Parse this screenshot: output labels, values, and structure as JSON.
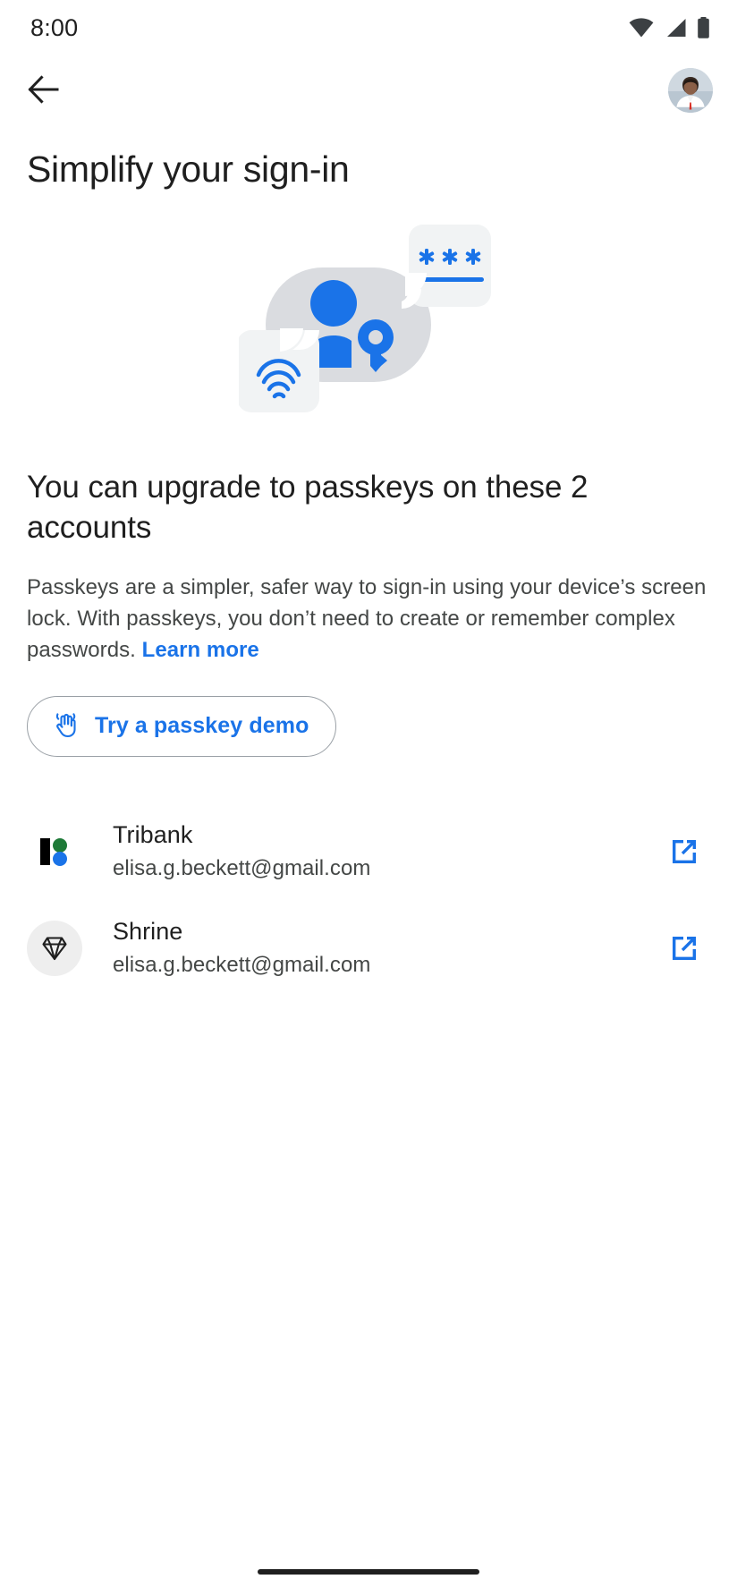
{
  "status_bar": {
    "time": "8:00",
    "icons": [
      "wifi-icon",
      "cellular-signal-icon",
      "battery-icon"
    ]
  },
  "app_bar": {
    "back_icon": "back-arrow-icon",
    "avatar_label": "Account avatar"
  },
  "page": {
    "title": "Simplify your sign-in"
  },
  "illustration": {
    "name": "passkey-illustration",
    "parts": [
      "person-with-key-icon",
      "fingerprint-card-icon",
      "password-asterisks-card-icon"
    ],
    "asterisks": "✻✻✻",
    "colors": {
      "accent_blue": "#1a73e8",
      "blob_gray": "#dadce0",
      "card_gray": "#f1f3f4"
    }
  },
  "main": {
    "headline": "You can upgrade to passkeys on these 2 accounts",
    "body_before_link": "Passkeys are a simpler, safer way to sign-in using your device’s screen lock. With passkeys, you don’t need to create or remember complex passwords. ",
    "learn_more_label": "Learn more",
    "demo_button": {
      "label": "Try a passkey demo",
      "icon": "touch-hand-icon"
    }
  },
  "accounts": [
    {
      "name": "Tribank",
      "email": "elisa.g.beckett@gmail.com",
      "logo": "tribank-logo-icon",
      "action_icon": "open-in-new-icon"
    },
    {
      "name": "Shrine",
      "email": "elisa.g.beckett@gmail.com",
      "logo": "shrine-diamond-icon",
      "action_icon": "open-in-new-icon"
    }
  ],
  "nav_bar": {
    "handle": "gesture-nav-handle"
  }
}
